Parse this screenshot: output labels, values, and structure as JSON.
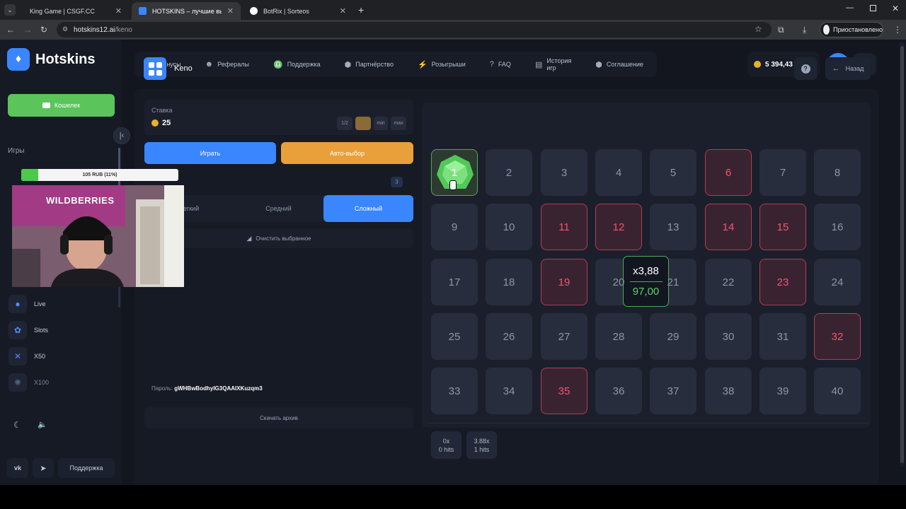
{
  "browser": {
    "tabs": [
      {
        "title": "King Game | CSGF.CC",
        "color": "#e6e6e6"
      },
      {
        "title": "HOTSKINS – лучшие выигрыш",
        "color": "#3a86ff"
      },
      {
        "title": "BotRix | Sorteos",
        "color": "#ffffff"
      }
    ],
    "url_host": "hotskins12.ai",
    "url_path": "/keno",
    "profile_status": "Приостановлено"
  },
  "site": {
    "logo": "Hotskins",
    "wallet_label": "Кошелек",
    "games_heading": "Игры",
    "sidebar_games": [
      {
        "label": "Live",
        "icon": "live-icon"
      },
      {
        "label": "Slots",
        "icon": "slots-icon"
      },
      {
        "label": "X50",
        "icon": "x50-icon"
      },
      {
        "label": "X100",
        "icon": "x100-icon"
      }
    ],
    "support_label": "Поддержка",
    "nav": [
      {
        "label": "Бонусы",
        "icon": "gift-icon"
      },
      {
        "label": "Рефералы",
        "icon": "users-icon"
      },
      {
        "label": "Поддержка",
        "icon": "headset-icon"
      },
      {
        "label": "Партнёрство",
        "icon": "handshake-icon"
      },
      {
        "label": "Розыгрыши",
        "icon": "bolt-icon"
      },
      {
        "label": "FAQ",
        "icon": "question-icon"
      },
      {
        "label": "История игр",
        "icon": "history-icon"
      },
      {
        "label": "Соглашение",
        "icon": "agreement-icon"
      }
    ],
    "balance": "5 394,43"
  },
  "game": {
    "title": "Keno",
    "back_label": "Назад",
    "bet_label": "Ставка",
    "bet_value": "25",
    "bet_chips": [
      "1/2",
      "x2",
      "min",
      "max"
    ],
    "play_label": "Играть",
    "auto_label": "Авто-выбор",
    "risk_count": "3",
    "risk_options": [
      "Легкий",
      "Средний",
      "Сложный"
    ],
    "risk_selected": "Сложный",
    "clear_label": "Очистить выбранное",
    "seed_label": "Пароль:",
    "seed_value": "gWHBwBodhyIG3QAAIXKuzqm3",
    "archive_label": "Скачать архив",
    "selected_numbers": [
      6,
      11,
      12,
      14,
      15,
      19,
      23,
      32,
      35
    ],
    "hit_numbers": [
      1
    ],
    "payouts": [
      {
        "multiplier": "0x",
        "hits": "0 hits"
      },
      {
        "multiplier": "3.88x",
        "hits": "1 hits"
      }
    ],
    "tooltip": {
      "multiplier": "x3,88",
      "win": "97,00"
    }
  },
  "stream_overlay": {
    "progress_text": "105 RUB (11%)",
    "progress_percent": 11,
    "webcam_sign": "WILDBERRIES"
  },
  "colors": {
    "accent": "#3a86ff",
    "wallet_green": "#5bc45b",
    "auto_orange": "#e9a03a",
    "selected_red": "#f0566f",
    "hit_green": "#5fcf6a"
  }
}
